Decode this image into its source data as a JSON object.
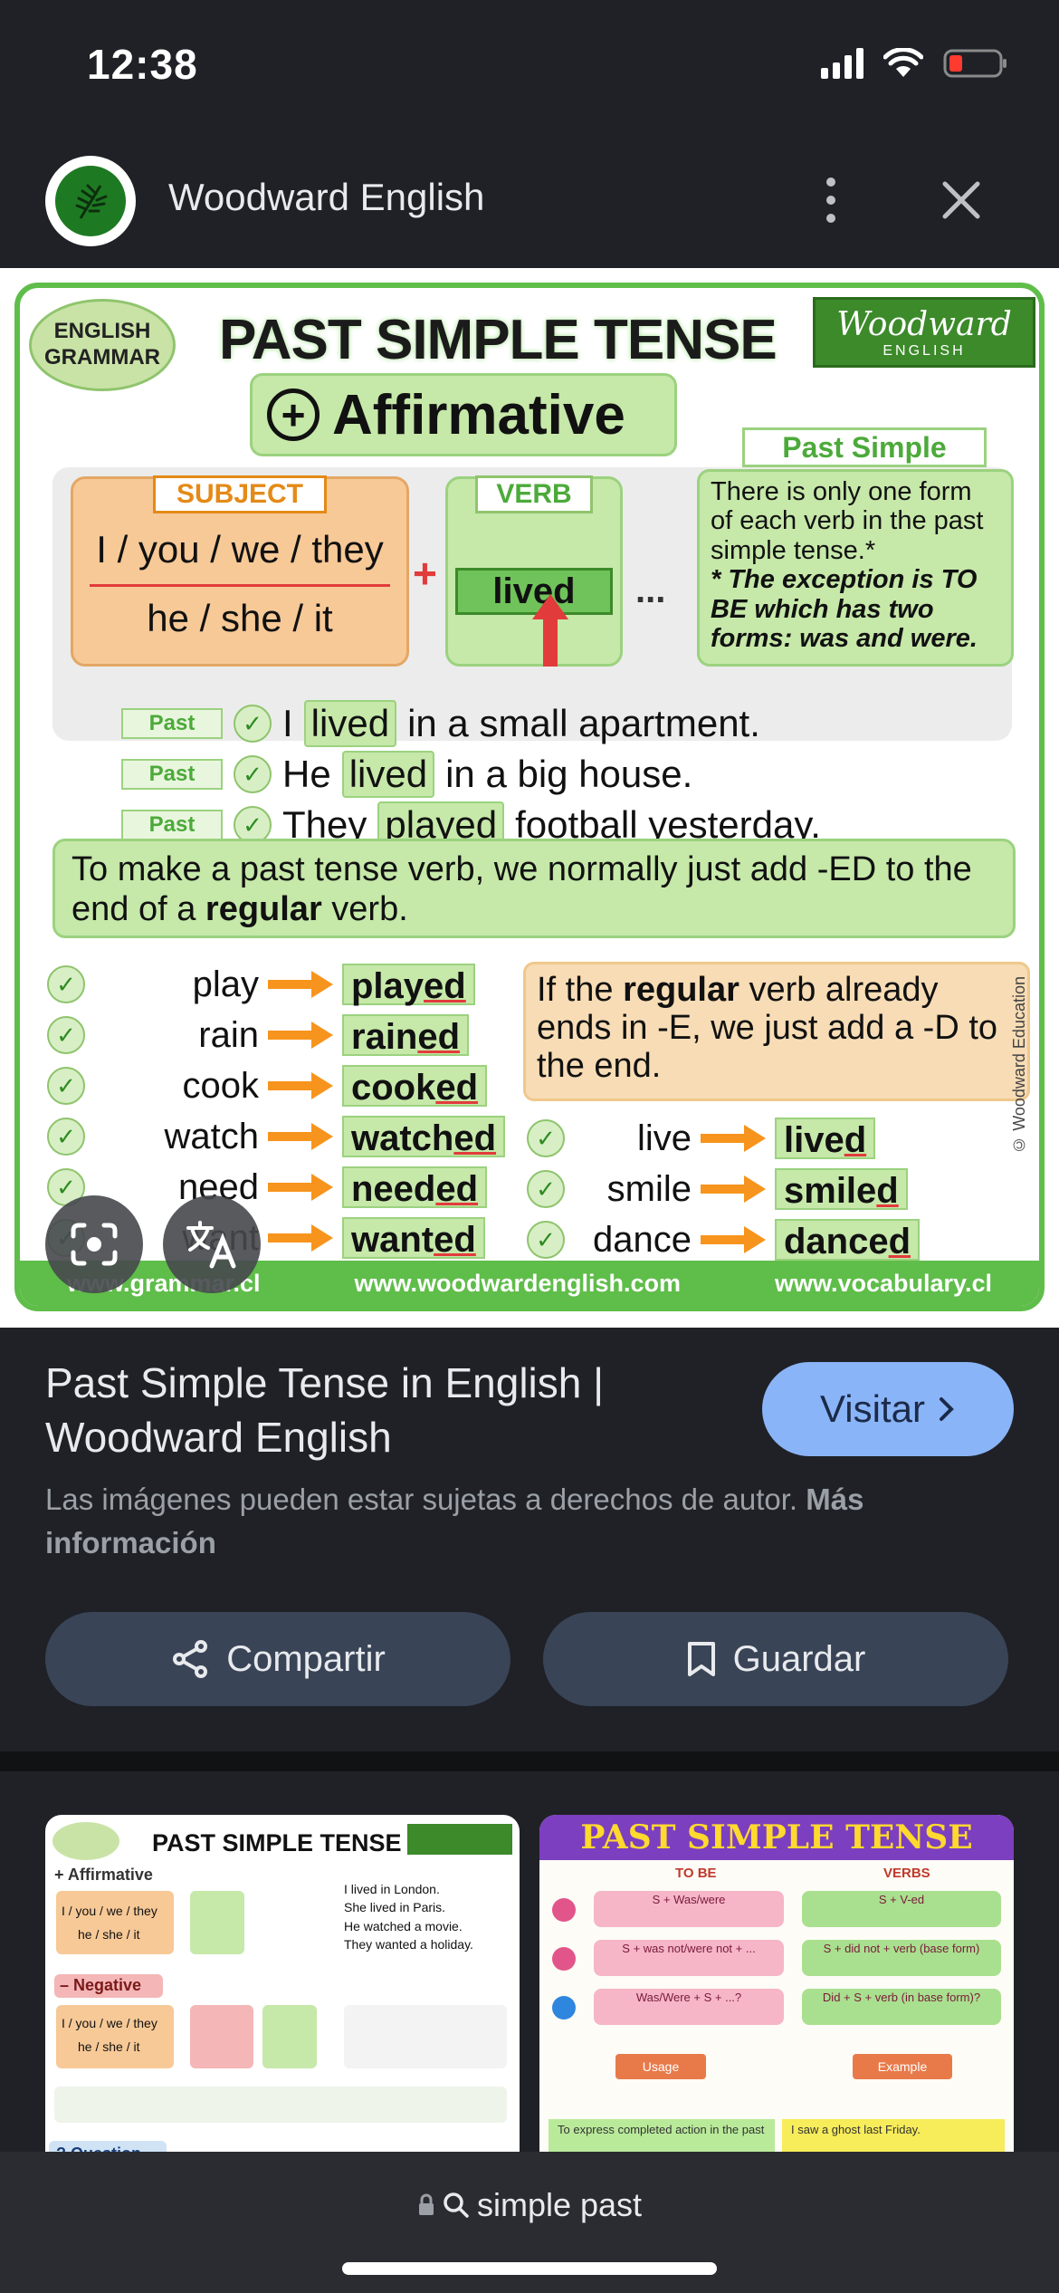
{
  "status_bar": {
    "time": "12:38"
  },
  "header": {
    "site_name": "Woodward English"
  },
  "preview": {
    "badge_line1": "ENGLISH",
    "badge_line2": "GRAMMAR",
    "title": "PAST SIMPLE TENSE",
    "brand_line1": "Woodward",
    "brand_line2": "ENGLISH",
    "affirmative": "Affirmative",
    "past_simple_label": "Past Simple",
    "subject_tag": "SUBJECT",
    "subject_line1": "I / you / we / they",
    "subject_line2": "he / she / it",
    "verb_tag": "VERB",
    "verb_word": "lived",
    "ellipsis": "...",
    "info_text": "There is only one form of each verb in the past simple tense.*",
    "info_note": "* The exception is TO BE which has two forms: was and were.",
    "examples": [
      {
        "tag": "Past",
        "pre": "I",
        "verb": "lived",
        "post": "in a small apartment."
      },
      {
        "tag": "Past",
        "pre": "He",
        "verb": "lived",
        "post": "in a big house."
      },
      {
        "tag": "Past",
        "pre": "They",
        "verb": "played",
        "post": "football yesterday."
      }
    ],
    "rule_part1": "To make a past tense verb, we normally just add -ED to the end of a ",
    "rule_bold": "regular",
    "rule_part2": " verb.",
    "verbs_left": [
      {
        "base": "play",
        "stem": "play",
        "suffix": "ed"
      },
      {
        "base": "rain",
        "stem": "rain",
        "suffix": "ed"
      },
      {
        "base": "cook",
        "stem": "cook",
        "suffix": "ed"
      },
      {
        "base": "watch",
        "stem": "watch",
        "suffix": "ed"
      },
      {
        "base": "need",
        "stem": "need",
        "suffix": "ed"
      },
      {
        "base": "want",
        "stem": "want",
        "suffix": "ed"
      }
    ],
    "e_rule_part1": "If the ",
    "e_rule_bold": "regular",
    "e_rule_part2": " verb already ends in -E, we just add a -D to the end.",
    "verbs_right": [
      {
        "base": "live",
        "stem": "live",
        "suffix": "d"
      },
      {
        "base": "smile",
        "stem": "smile",
        "suffix": "d"
      },
      {
        "base": "dance",
        "stem": "dance",
        "suffix": "d"
      }
    ],
    "side_credit": "© Woodward Education",
    "footer_links": [
      "www.grammar.cl",
      "www.woodwardenglish.com",
      "www.vocabulary.cl"
    ]
  },
  "result": {
    "title": "Past Simple Tense in English | Woodward English",
    "visit_label": "Visitar",
    "copyright_text": "Las imágenes pueden estar sujetas a derechos de autor.",
    "copyright_link": "Más información",
    "share_label": "Compartir",
    "save_label": "Guardar"
  },
  "related": {
    "thumb1": {
      "title": "PAST SIMPLE TENSE",
      "rows": [
        "+ Affirmative",
        "I / you / we / they",
        "he / she / it",
        "– Negative",
        "I / you / we / they",
        "he / she / it",
        "? Question"
      ],
      "sentences": [
        "I lived in London.",
        "She lived in Paris.",
        "He watched a movie.",
        "They wanted a holiday."
      ]
    },
    "thumb2": {
      "title": "PAST SIMPLE TENSE",
      "col1": "TO BE",
      "col2": "VERBS",
      "pills": [
        "S + Was/were",
        "S + V-ed",
        "S + was not/were not + ...",
        "S + did not + verb (base form)",
        "Was/Were + S + ...?",
        "Did + S + verb (in base form)?"
      ],
      "usage": "Usage",
      "example": "Example",
      "foot1": "To express completed action in the past",
      "foot2": "I saw a ghost last Friday."
    }
  },
  "bottom": {
    "query": "simple past"
  },
  "colors": {
    "accent": "#8ab4f8",
    "green": "#5fbd4a",
    "orange": "#f7941d"
  }
}
